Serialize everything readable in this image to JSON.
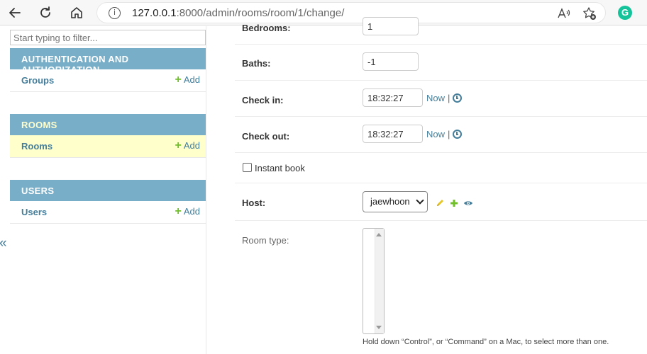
{
  "browser": {
    "url_host": "127.0.0.1",
    "url_rest": ":8000/admin/rooms/room/1/change/",
    "extension_letter": "G"
  },
  "sidebar": {
    "filter_placeholder": "Start typing to filter...",
    "modules": [
      {
        "caption": "AUTHENTICATION AND AUTHORIZATION",
        "rows": [
          {
            "label": "Groups",
            "add": "Add"
          }
        ]
      },
      {
        "caption": "ROOMS",
        "rows": [
          {
            "label": "Rooms",
            "add": "Add"
          }
        ],
        "active": true
      },
      {
        "caption": "USERS",
        "rows": [
          {
            "label": "Users",
            "add": "Add"
          }
        ]
      }
    ],
    "collapse_glyph": "«"
  },
  "form": {
    "bedrooms": {
      "label": "Bedrooms:",
      "value": "1"
    },
    "baths": {
      "label": "Baths:",
      "value": "-1"
    },
    "check_in": {
      "label": "Check in:",
      "value": "18:32:27",
      "now": "Now",
      "sep": "|"
    },
    "check_out": {
      "label": "Check out:",
      "value": "18:32:27",
      "now": "Now",
      "sep": "|"
    },
    "instant_book": {
      "label": "Instant book",
      "checked": false
    },
    "host": {
      "label": "Host:",
      "selected": "jaewhoon"
    },
    "room_type": {
      "label": "Room type:",
      "help": "Hold down “Control”, or “Command” on a Mac, to select more than one."
    }
  },
  "colors": {
    "module_header": "#79aec8",
    "link": "#447e9b",
    "add_plus": "#70bf2b",
    "active_row": "#ffffcc",
    "change_icon": "#e4c625"
  }
}
